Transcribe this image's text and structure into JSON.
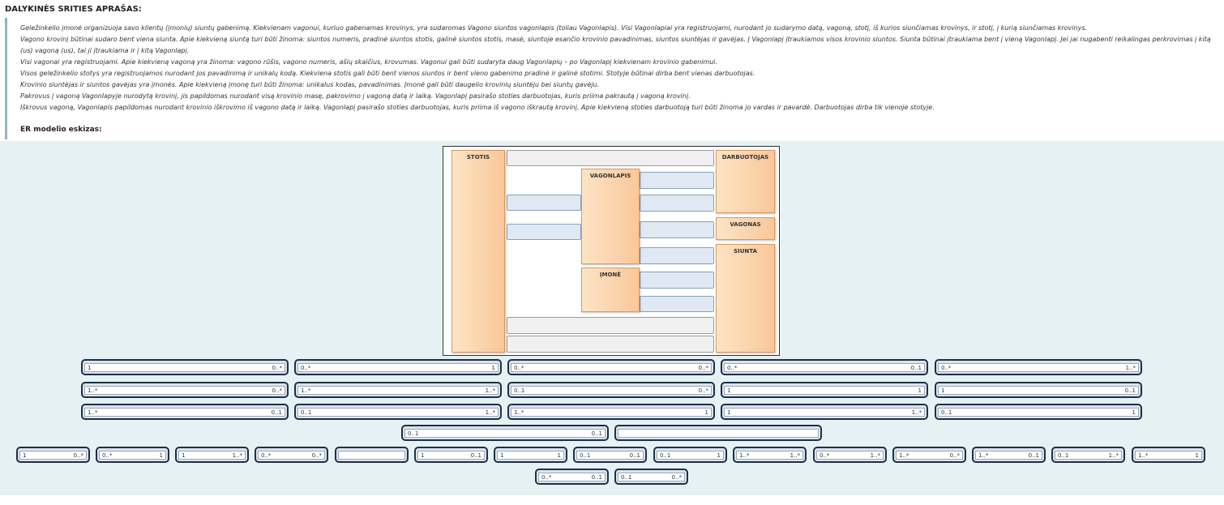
{
  "heading": "DALYKINĖS SRITIES APRAŠAS:",
  "paragraphs": [
    "Geležinkelio įmonė organizuoja savo klientų (įmonių) siuntų gabenimą. Kiekvienam vagonui, kuriuo gabenamas krovinys, yra sudaromas Vagono siuntos vagonlapis (toliau Vagonlapis). Visi Vagonlapiai yra registruojami, nurodant jo sudarymo datą, vagoną, stotį, iš kurios siunčiamas krovinys, ir stotį, į kurią siunčiamas krovinys.",
    "Vagono krovinį būtinai sudaro bent viena siunta. Apie kiekvieną siuntą turi būti žinoma: siuntos numeris, pradinė siuntos stotis, galinė siuntos stotis, masė, siuntoje esančio krovinio pavadinimas, siuntos siuntėjas ir gavėjas. Į Vagonlapį įtraukiamos visos krovinio siuntos. Siunta būtinai įtraukiama bent į vieną Vagonlapį. Jei jai nugabenti reikalingas perkrovimas į kitą",
    "(us) vagoną (us), tai ji įtraukiama ir į kitą Vagonlapį.",
    "Visi vagonai yra registruojami. Apie kiekvieną vagoną yra žinoma: vagono rūšis, vagono numeris, ašių skaičius, krovumas.  Vagonui gali būti sudaryta daug Vagonlapių – po Vagonlapį kiekvienam krovinio gabenimui.",
    "Visos geležinkelio stotys yra registruojamos nurodant jos pavadinimą ir unikalų kodą. Kiekviena stotis gali būti bent vienos siuntos ir bent vieno gabenimo pradinė ir galinė stotimi. Stotyje būtinai dirba bent vienas darbuotojas.",
    "Krovinio siuntėjas ir siuntos gavėjas yra įmonės. Apie kiekvieną įmonę turi būti žinoma: unikalus kodas, pavadinimas. Įmonė gali būti daugelio krovinių siuntėju bei siuntų gavėju.",
    "Pakrovus į vagoną Vagonlapyje nurodytą krovinį, jis papildomas nurodant visą krovinio masę, pakrovimo į vagoną datą ir laiką. Vagonlapį pasirašo stoties darbuotojas, kuris priima pakrautą į vagoną krovinį.",
    "Iškrovus vagoną, Vagonlapis papildomas nurodant krovinio iškrovimo iš vagono  datą ir laiką. Vagonlapį pasirašo stoties darbuotojas, kuris priima iš vagono iškrautą krovinį. Apie kiekvieną stoties darbuotoją turi būti žinoma jo vardas ir pavardė. Darbuotojas dirba tik vienoje stotyje."
  ],
  "er_title": "ER modelio eskizas:",
  "entities": {
    "stotis": "STOTIS",
    "darbuotojas": "DARBUOTOJAS",
    "vagonlapis": "VAGONLAPIS",
    "vagonas": "VAGONAS",
    "siunta": "SIUNTA",
    "imone": "ĮMONĖ"
  },
  "cards_row1": [
    [
      "1",
      "0..*"
    ],
    [
      "0..*",
      "1"
    ],
    [
      "0..*",
      "0..*"
    ],
    [
      "0..*",
      "0..1"
    ],
    [
      "0..*",
      "1..*"
    ]
  ],
  "cards_row2": [
    [
      "1..*",
      "0..*"
    ],
    [
      "1..*",
      "1..*"
    ],
    [
      "0..1",
      "0..*"
    ],
    [
      "1",
      "1"
    ],
    [
      "1",
      "0..1"
    ]
  ],
  "cards_row3": [
    [
      "1..*",
      "0..1"
    ],
    [
      "0..1",
      "1..*"
    ],
    [
      "1..*",
      "1"
    ],
    [
      "1",
      "1..*"
    ],
    [
      "0..1",
      "1"
    ]
  ],
  "cards_row4": [
    [
      "0..1",
      "0..1"
    ],
    [
      "",
      ""
    ]
  ],
  "cards_row5": [
    [
      "1",
      "0..*"
    ],
    [
      "0..*",
      "1"
    ],
    [
      "1",
      "1..*"
    ],
    [
      "0..*",
      "0..*"
    ],
    [
      "",
      ""
    ],
    [
      "1",
      "0..1"
    ],
    [
      "1",
      "1"
    ],
    [
      "0..1",
      "0..1"
    ],
    [
      "0..1",
      "1"
    ],
    [
      "1..*",
      "1..*"
    ],
    [
      "0..*",
      "1..*"
    ],
    [
      "1..*",
      "0..*"
    ],
    [
      "1..*",
      "0..1"
    ],
    [
      "0..1",
      "1..*"
    ],
    [
      "1..*",
      "1"
    ]
  ],
  "cards_row6": [
    [
      "0..*",
      "0..1"
    ],
    [
      "0..1",
      "0..*"
    ]
  ]
}
